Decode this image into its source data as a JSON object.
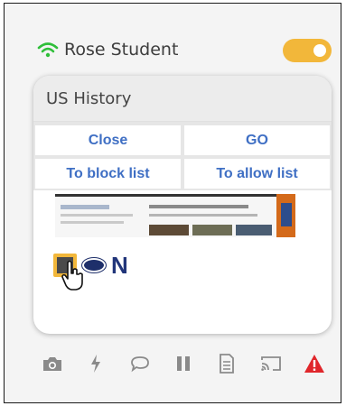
{
  "student": {
    "name": "Rose Student",
    "status_icon": "wifi-icon",
    "toggle_on": true
  },
  "card": {
    "title": "US History",
    "buttons": {
      "close": "Close",
      "go": "GO",
      "block": "To block list",
      "allow": "To allow list"
    },
    "favicons": [
      "site-favicon-icon",
      "oval-logo-icon",
      "n-logo-icon"
    ],
    "fav3_letter": "N"
  },
  "toolbar": {
    "icons": [
      "camera-icon",
      "lightning-icon",
      "chat-icon",
      "pause-icon",
      "document-icon",
      "cast-icon",
      "warning-icon"
    ]
  },
  "colors": {
    "accent": "#f2b73a",
    "link_blue": "#3f6fc4",
    "wifi_green": "#2fbf3a",
    "warning_red": "#e0262b",
    "icon_gray": "#8a8a8a"
  }
}
